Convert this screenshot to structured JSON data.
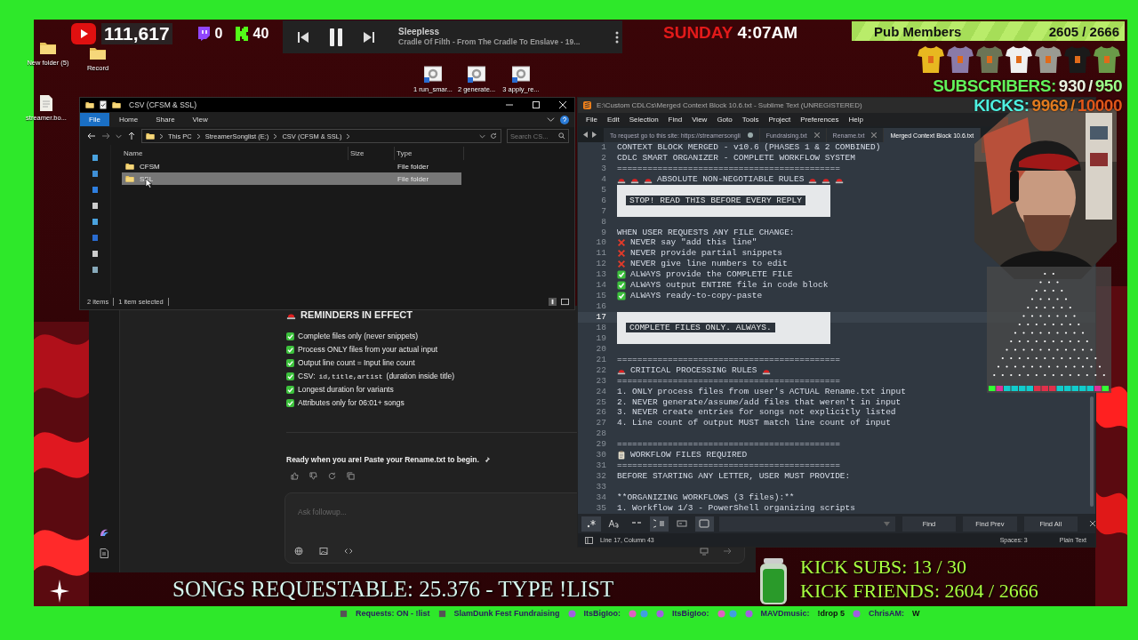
{
  "stream_stats": {
    "youtube": "111,617",
    "twitch": "0",
    "kick": "40"
  },
  "media_player": {
    "title": "Sleepless",
    "subtitle": "Cradle Of Filth - From The Cradle To Enslave - 19...",
    "playing": true
  },
  "clock": {
    "day": "SUNDAY",
    "time": "4:07AM"
  },
  "pub_members": {
    "label": "Pub Members",
    "count": "2605 / 2666"
  },
  "merch": [
    {
      "color": "#e8b820"
    },
    {
      "color": "#8a7aa8"
    },
    {
      "color": "#6b7455"
    },
    {
      "color": "#f0f0f0"
    },
    {
      "color": "#9a9a92"
    },
    {
      "color": "#1a1a1a"
    },
    {
      "color": "#6a9a48"
    }
  ],
  "goals": [
    {
      "kind": "subscribers",
      "label": "SUBSCRIBERS:",
      "current": "930",
      "separator": "/",
      "target": "950"
    },
    {
      "kind": "kicks",
      "label": "KICKS:",
      "current": "9969",
      "separator": "/",
      "target": "10000"
    }
  ],
  "desktop_icons": [
    {
      "kind": "folder",
      "label": "New folder (5)"
    },
    {
      "kind": "folder",
      "label": "Record"
    },
    {
      "kind": "file",
      "label": "streamer.bo..."
    },
    {
      "kind": "shortcut",
      "label": "1 run_smar..."
    },
    {
      "kind": "shortcut",
      "label": "2 generate..."
    },
    {
      "kind": "shortcut",
      "label": "3 apply_re..."
    }
  ],
  "explorer": {
    "title": "CSV (CFSM & SSL)",
    "ribbon_tabs": [
      {
        "label": "File",
        "selected": true
      },
      {
        "label": "Home",
        "selected": false
      },
      {
        "label": "Share",
        "selected": false
      },
      {
        "label": "View",
        "selected": false
      }
    ],
    "path": [
      "This PC",
      "StreamerSonglist (E:)",
      "CSV (CFSM & SSL)"
    ],
    "search": {
      "placeholder": "Search CS..."
    },
    "columns": [
      "Name",
      "Size",
      "Type"
    ],
    "rows": [
      {
        "name": "CFSM",
        "type": "File folder",
        "selected": false
      },
      {
        "name": "SSL",
        "type": "File folder",
        "selected": true
      }
    ],
    "status": [
      "2 items",
      "1 item selected"
    ]
  },
  "chat": {
    "heading": "REMINDERS IN EFFECT",
    "checklist": [
      {
        "text": "Complete files only (never snippets)",
        "checked": true
      },
      {
        "text": "Process ONLY files from your actual input",
        "checked": true
      },
      {
        "text": "Output line count = Input line count",
        "checked": true
      },
      {
        "text": "CSV:",
        "code": "id,title,artist",
        "note": "(duration inside title)",
        "checked": true
      },
      {
        "text": "Longest duration for variants",
        "checked": true
      },
      {
        "text": "Attributes only for 06:01+ songs",
        "checked": true
      }
    ],
    "message": "Ready when you are! Paste your Rename.txt to begin.",
    "input": {
      "placeholder": "Ask followup..."
    }
  },
  "sublime": {
    "title": "E:\\Custom CDLCs\\Merged Context Block 10.6.txt - Sublime Text (UNREGISTERED)",
    "menu": [
      "File",
      "Edit",
      "Selection",
      "Find",
      "View",
      "Goto",
      "Tools",
      "Project",
      "Preferences",
      "Help"
    ],
    "tabs": [
      {
        "label": "To request go to this site: https://streamersongli",
        "selected": false,
        "modified": true
      },
      {
        "label": "Fundraising.txt",
        "selected": false,
        "modified": false
      },
      {
        "label": "Rename.txt",
        "selected": false,
        "modified": false
      },
      {
        "label": "Merged Context Block 10.6.txt",
        "selected": true,
        "modified": false
      }
    ],
    "lines": [
      {
        "n": "1",
        "text": "CONTEXT BLOCK MERGED - v10.6 (PHASES 1 & 2 COMBINED)",
        "current": false
      },
      {
        "n": "2",
        "text": "CDLC SMART ORGANIZER - COMPLETE WORKFLOW SYSTEM",
        "current": false
      },
      {
        "n": "3",
        "text": "============================================",
        "current": false
      },
      {
        "n": "4",
        "text": "ABSOLUTE NON-NEGOTIABLE RULES",
        "lead": [
          {
            "kind": "siren"
          },
          {
            "kind": "siren"
          },
          {
            "kind": "siren"
          }
        ],
        "trail": [
          {
            "kind": "siren"
          },
          {
            "kind": "siren"
          },
          {
            "kind": "siren"
          }
        ],
        "current": false
      },
      {
        "n": "5",
        "kind": "banner",
        "current": false
      },
      {
        "n": "6",
        "kind": "banner",
        "text": "STOP! READ THIS BEFORE EVERY REPLY",
        "current": false
      },
      {
        "n": "7",
        "kind": "banner",
        "current": false
      },
      {
        "n": "8",
        "current": false
      },
      {
        "n": "9",
        "text": "WHEN USER REQUESTS ANY FILE CHANGE:",
        "current": false
      },
      {
        "n": "10",
        "text": "NEVER say \"add this line\"",
        "lead": [
          {
            "kind": "cross"
          }
        ],
        "current": false
      },
      {
        "n": "11",
        "text": "NEVER provide partial snippets",
        "lead": [
          {
            "kind": "cross"
          }
        ],
        "current": false
      },
      {
        "n": "12",
        "text": "NEVER give line numbers to edit",
        "lead": [
          {
            "kind": "cross"
          }
        ],
        "current": false
      },
      {
        "n": "13",
        "text": "ALWAYS provide the COMPLETE FILE",
        "lead": [
          {
            "kind": "check"
          }
        ],
        "current": false
      },
      {
        "n": "14",
        "text": "ALWAYS output ENTIRE file in code block",
        "lead": [
          {
            "kind": "check"
          }
        ],
        "current": false
      },
      {
        "n": "15",
        "text": "ALWAYS ready-to-copy-paste",
        "lead": [
          {
            "kind": "check"
          }
        ],
        "current": false
      },
      {
        "n": "16",
        "current": false
      },
      {
        "n": "17",
        "kind": "banner",
        "current": true
      },
      {
        "n": "18",
        "kind": "banner",
        "text": "COMPLETE FILES ONLY. ALWAYS.",
        "current": false
      },
      {
        "n": "19",
        "kind": "banner",
        "current": false
      },
      {
        "n": "20",
        "current": false
      },
      {
        "n": "21",
        "text": "============================================",
        "current": false
      },
      {
        "n": "22",
        "text": "CRITICAL PROCESSING RULES",
        "lead": [
          {
            "kind": "siren"
          }
        ],
        "trail": [
          {
            "kind": "siren"
          }
        ],
        "current": false
      },
      {
        "n": "23",
        "text": "============================================",
        "current": false
      },
      {
        "n": "24",
        "text": "1. ONLY process files from user's ACTUAL Rename.txt input",
        "current": false
      },
      {
        "n": "25",
        "text": "2. NEVER generate/assume/add files that weren't in input",
        "current": false
      },
      {
        "n": "26",
        "text": "3. NEVER create entries for songs not explicitly listed",
        "current": false
      },
      {
        "n": "27",
        "text": "4. Line count of output MUST match line count of input",
        "current": false
      },
      {
        "n": "28",
        "current": false
      },
      {
        "n": "29",
        "text": "============================================",
        "current": false
      },
      {
        "n": "30",
        "text": "WORKFLOW FILES REQUIRED",
        "lead": [
          {
            "kind": "clipboard"
          }
        ],
        "current": false
      },
      {
        "n": "31",
        "text": "============================================",
        "current": false
      },
      {
        "n": "32",
        "text": "BEFORE STARTING ANY LETTER, USER MUST PROVIDE:",
        "current": false
      },
      {
        "n": "33",
        "current": false
      },
      {
        "n": "34",
        "text": "**ORGANIZING WORKFLOWS (3 files):**",
        "current": false
      },
      {
        "n": "35",
        "text": "1. Workflow 1/3 - PowerShell organizing scripts",
        "current": false
      }
    ],
    "find_buttons": [
      "Find",
      "Find Prev",
      "Find All"
    ],
    "status": {
      "position": "Line 17, Column 43",
      "indent": "Spaces: 3",
      "syntax": "Plain Text"
    }
  },
  "songs_banner": "SONGS REQUESTABLE: 25.376 - TYPE !LIST",
  "kick_goals": [
    "KICK SUBS: 13 / 30",
    "KICK FRIENDS: 2604 / 2666"
  ],
  "ticker": [
    {
      "kind": "info",
      "text": "Requests: ON - !list"
    },
    {
      "kind": "info",
      "text": "SlamDunk Fest Fundraising"
    },
    {
      "kind": "chat",
      "user": "ItsBigIoo:"
    },
    {
      "kind": "chat",
      "user": "ItsBigIoo:"
    },
    {
      "kind": "chat",
      "user": "MAVDmusic:",
      "message": "!drop 5"
    },
    {
      "kind": "chat",
      "user": "ChrisAM:",
      "message": "W"
    }
  ]
}
